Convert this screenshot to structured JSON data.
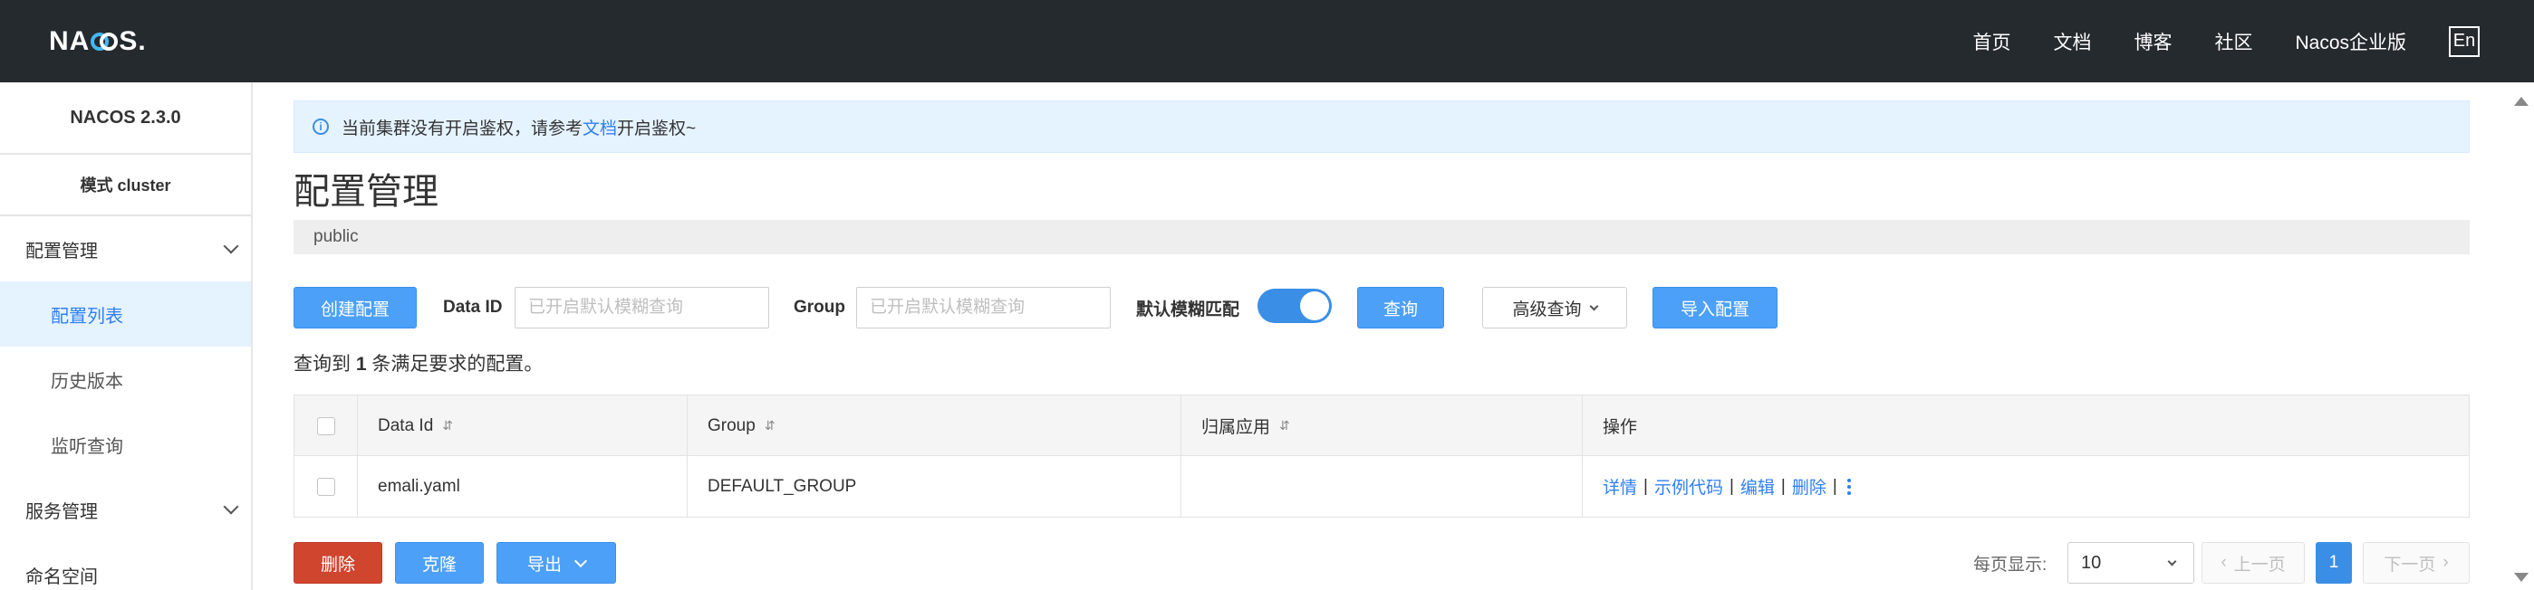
{
  "header": {
    "logo": {
      "prefix": "NA",
      "suffix": "S."
    },
    "nav": [
      "首页",
      "文档",
      "博客",
      "社区",
      "Nacos企业版"
    ],
    "lang": "En"
  },
  "sidebar": {
    "version": "NACOS 2.3.0",
    "mode": "模式 cluster",
    "groups": [
      {
        "label": "配置管理",
        "items": [
          "配置列表",
          "历史版本",
          "监听查询"
        ]
      },
      {
        "label": "服务管理"
      }
    ],
    "namespace": "命名空间"
  },
  "notice": {
    "prefix": "当前集群没有开启鉴权，请参考",
    "link": "文档",
    "suffix": "开启鉴权~"
  },
  "page": {
    "title": "配置管理",
    "namespace": "public"
  },
  "toolbar": {
    "create": "创建配置",
    "data_id_label": "Data ID",
    "data_id_placeholder": "已开启默认模糊查询",
    "group_label": "Group",
    "group_placeholder": "已开启默认模糊查询",
    "fuzzy_label": "默认模糊匹配",
    "search": "查询",
    "advanced": "高级查询",
    "import": "导入配置"
  },
  "result": {
    "prefix": "查询到",
    "count": "1",
    "suffix": "条满足要求的配置。"
  },
  "table": {
    "columns": [
      "Data Id",
      "Group",
      "归属应用",
      "操作"
    ],
    "rows": [
      {
        "data_id": "emali.yaml",
        "group": "DEFAULT_GROUP",
        "app": ""
      }
    ],
    "ops": [
      "详情",
      "示例代码",
      "编辑",
      "删除"
    ]
  },
  "footer": {
    "delete": "删除",
    "clone": "克隆",
    "export": "导出",
    "page_size_label": "每页显示:",
    "page_size": "10",
    "prev": "上一页",
    "current_page": "1",
    "next": "下一页"
  }
}
